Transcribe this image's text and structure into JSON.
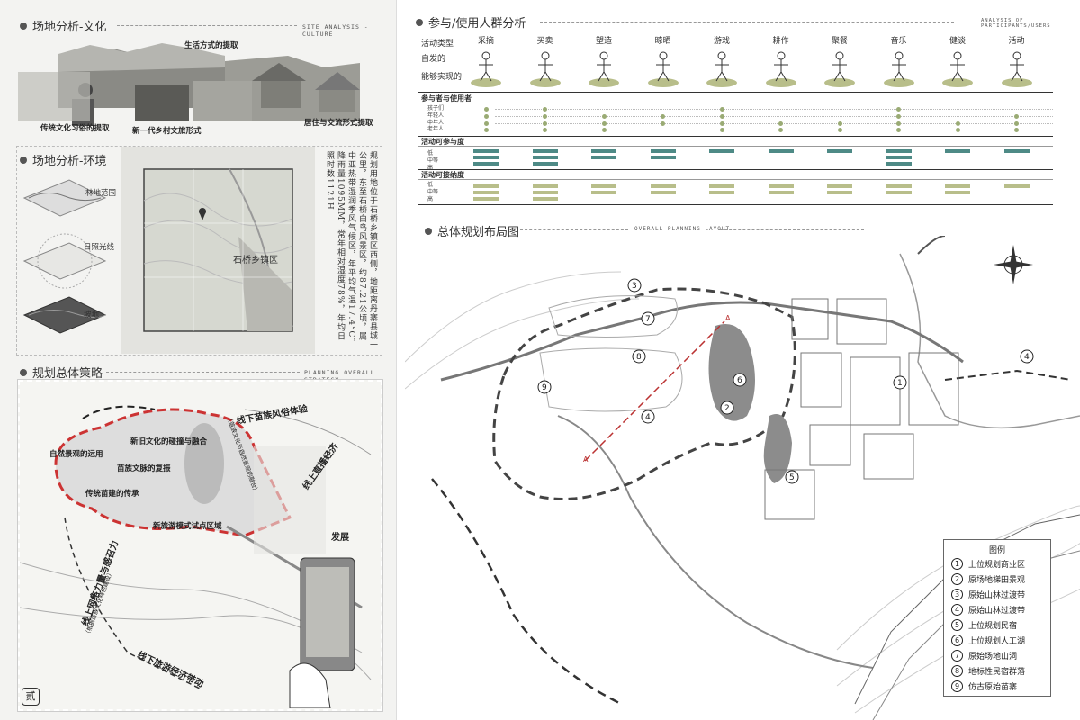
{
  "left": {
    "culture": {
      "title": "场地分析-文化",
      "title_en": "SITE ANALYSIS - CULTURE",
      "labels": {
        "lifestyle": "生活方式的提取",
        "traditional": "传统文化习俗的提取",
        "tourism": "新一代乡村文旅形式",
        "housing": "居住与交流形式提取"
      }
    },
    "environment": {
      "title": "场地分析-环境",
      "labels": {
        "forest": "林地范围",
        "sunlight": "日照光线",
        "slope": "坡地"
      },
      "map_label": "石桥乡镇区",
      "description": "规划用地位于石桥乡镇区西侧，地距离丹寨县城一公里，东至石桥白鸟风景区，约87.21公顷，属中亚热带湿润季风气候区，年平均气温17.4°C，降雨量1095MM，常年相对湿度78%，年均日照时数1121H"
    },
    "strategy": {
      "title": "规划总体策略",
      "title_en": "PLANNING OVERALL STRATEGY",
      "labels": {
        "landscape": "自然景观的运用",
        "fusion": "新旧文化的碰撞与融合",
        "revival": "苗族文脉的复振",
        "heritage": "传统苗建的传承",
        "pilot": "新旅游模式试点区域",
        "offline": "线下苗族风俗体验",
        "live": "线上直播经济",
        "develop": "发展",
        "online_power": "线上网络力量与感召力",
        "sub1": "（苗族文化与自然景观的融合）",
        "sub2": "（根据苗族文化特色建设）",
        "tourism_bottom": "线下旅游经济带动"
      },
      "page_mark": "贰"
    }
  },
  "right": {
    "participants": {
      "title": "参与/使用人群分析",
      "title_en": "ANALYSIS OF PARTICIPANTS/USERS",
      "row_head": [
        "活动类型",
        "自发的",
        "能够实现的"
      ],
      "activities": [
        "采摘",
        "买卖",
        "塑造",
        "晾晒",
        "游戏",
        "耕作",
        "聚餐",
        "音乐",
        "健谈",
        "活动"
      ],
      "section_participants": "参与者与使用者",
      "participant_groups": [
        "孩子们",
        "年轻人",
        "中年人",
        "老年人"
      ],
      "section_engagement": "活动可参与度",
      "engagement_levels": [
        "低",
        "中等",
        "高"
      ],
      "section_acceptance": "活动可接纳度",
      "acceptance_levels": [
        "低",
        "中等",
        "高"
      ],
      "colors": {
        "dot": "#9aab74",
        "engagement": "#4e8a86",
        "acceptance": "#b8be8a"
      },
      "participant_matrix": [
        [
          1,
          1,
          1,
          1
        ],
        [
          1,
          1,
          1,
          1
        ],
        [
          0,
          1,
          1,
          1
        ],
        [
          0,
          1,
          1,
          0
        ],
        [
          1,
          1,
          1,
          1
        ],
        [
          0,
          0,
          1,
          1
        ],
        [
          0,
          0,
          1,
          1
        ],
        [
          1,
          1,
          1,
          1
        ],
        [
          0,
          0,
          1,
          1
        ],
        [
          0,
          1,
          1,
          1
        ]
      ],
      "engagement_bars": [
        3,
        3,
        2,
        2,
        1,
        1,
        1,
        3,
        1,
        1
      ],
      "acceptance_bars": [
        3,
        3,
        2,
        2,
        2,
        2,
        2,
        2,
        2,
        1
      ]
    },
    "layout": {
      "title": "总体规划布局图",
      "title_en": "OVERALL PLANNING LAYOUT",
      "section_marker": "A",
      "legend_title": "图例",
      "legend": [
        {
          "num": "1",
          "label": "上位规划商业区"
        },
        {
          "num": "2",
          "label": "原场地梯田景观"
        },
        {
          "num": "3",
          "label": "原始山林过渡带"
        },
        {
          "num": "4",
          "label": "原始山林过渡带"
        },
        {
          "num": "5",
          "label": "上位规划民宿"
        },
        {
          "num": "6",
          "label": "上位规划人工湖"
        },
        {
          "num": "7",
          "label": "原始场地山洞"
        },
        {
          "num": "8",
          "label": "地标性民宿群落"
        },
        {
          "num": "9",
          "label": "仿古原始苗寨"
        }
      ]
    }
  }
}
